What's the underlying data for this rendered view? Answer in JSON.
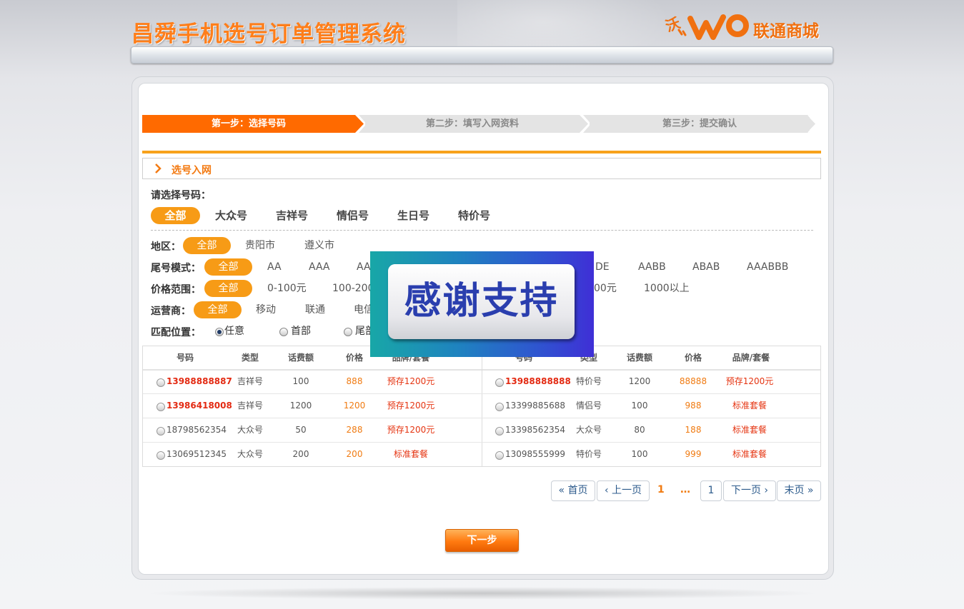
{
  "header": {
    "title": "昌舜手机选号订单管理系统",
    "brand": "联通商城",
    "brand_mark": "沃"
  },
  "steps": [
    {
      "label": "第一步：选择号码",
      "active": true
    },
    {
      "label": "第二步：填写入网资料",
      "active": false
    },
    {
      "label": "第三步：提交确认",
      "active": false
    }
  ],
  "section": {
    "title": "选号入网"
  },
  "number_select": {
    "label": "请选择号码：",
    "tabs": [
      "全部",
      "大众号",
      "吉祥号",
      "情侣号",
      "生日号",
      "特价号"
    ],
    "active": "全部"
  },
  "filters": {
    "region": {
      "label": "地区：",
      "options": [
        "全部",
        "贵阳市",
        "遵义市"
      ]
    },
    "tail": {
      "label": "尾号模式：",
      "options": [
        "全部",
        "AA",
        "AAA",
        "AA",
        "DE",
        "AABB",
        "ABAB",
        "AAABBB"
      ]
    },
    "price": {
      "label": "价格范围：",
      "options": [
        "全部",
        "0-100元",
        "100-200",
        "00元",
        "1000以上"
      ]
    },
    "carrier": {
      "label": "运营商：",
      "options": [
        "全部",
        "移动",
        "联通",
        "电信"
      ]
    },
    "match": {
      "label": "匹配位置：",
      "options": [
        "任意",
        "首部",
        "尾部"
      ],
      "selected": "任意"
    }
  },
  "table": {
    "headers": [
      "号码",
      "类型",
      "话费额",
      "价格",
      "品牌/套餐"
    ],
    "left_rows": [
      {
        "number": "13988888887",
        "type": "吉祥号",
        "fee": "100",
        "price": "888",
        "package": "预存1200元",
        "highlight": true
      },
      {
        "number": "13986418008",
        "type": "吉祥号",
        "fee": "1200",
        "price": "1200",
        "package": "预存1200元",
        "highlight": true
      },
      {
        "number": "18798562354",
        "type": "大众号",
        "fee": "50",
        "price": "288",
        "package": "预存1200元",
        "highlight": false
      },
      {
        "number": "13069512345",
        "type": "大众号",
        "fee": "200",
        "price": "200",
        "package": "标准套餐",
        "highlight": false
      }
    ],
    "right_rows": [
      {
        "number": "13988888888",
        "type": "特价号",
        "fee": "1200",
        "price": "88888",
        "package": "预存1200元",
        "highlight": true
      },
      {
        "number": "13399885688",
        "type": "情侣号",
        "fee": "100",
        "price": "988",
        "package": "标准套餐",
        "highlight": false
      },
      {
        "number": "13398562354",
        "type": "大众号",
        "fee": "80",
        "price": "188",
        "package": "标准套餐",
        "highlight": false
      },
      {
        "number": "13098555999",
        "type": "特价号",
        "fee": "100",
        "price": "999",
        "package": "标准套餐",
        "highlight": false
      }
    ]
  },
  "pager": {
    "first": "« 首页",
    "prev": "‹ 上一页",
    "current": "1",
    "ellipsis": "…",
    "last_num": "1",
    "next": "下一页 ›",
    "last": "末页 »"
  },
  "next_button": "下一步",
  "overlay": {
    "text": "感谢支持"
  },
  "colors": {
    "accent": "#ff6a00",
    "orange_line": "#f7a21b",
    "pill": "#f79b16",
    "number_red": "#e32a12",
    "price_orange": "#f07b12",
    "overlay_text": "#2a3eae"
  }
}
